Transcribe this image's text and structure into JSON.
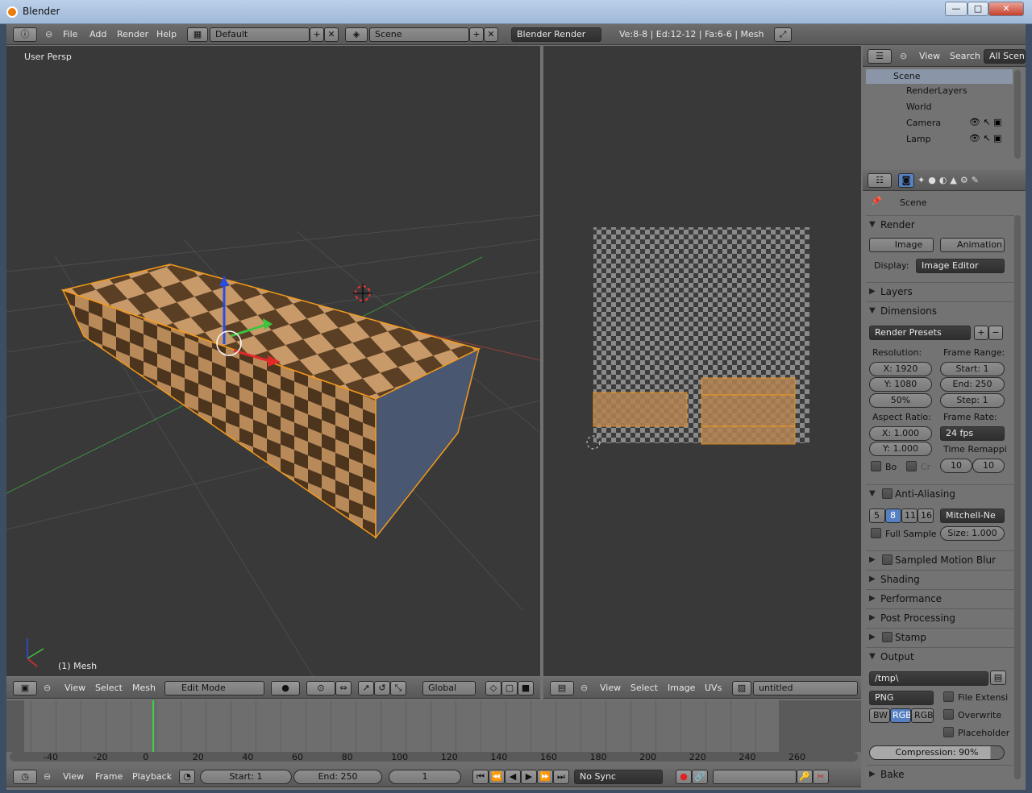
{
  "window": {
    "title": "Blender",
    "min": "—",
    "max": "□",
    "close": "✕"
  },
  "topbar": {
    "menus": [
      "File",
      "Add",
      "Render",
      "Help"
    ],
    "layout": "Default",
    "scene": "Scene",
    "engine": "Blender Render",
    "stats": "Ve:8-8 | Ed:12-12 | Fa:6-6 | Mesh"
  },
  "view3d": {
    "label": "User Persp",
    "object_label": "(1) Mesh",
    "header": {
      "menus": [
        "View",
        "Select",
        "Mesh"
      ],
      "mode": "Edit Mode",
      "orientation": "Global"
    }
  },
  "imageeditor": {
    "header": {
      "menus": [
        "View",
        "Select",
        "Image",
        "UVs"
      ],
      "image": "untitled"
    }
  },
  "outliner": {
    "menus": [
      "View",
      "Search"
    ],
    "filter": "All Scen",
    "items": [
      {
        "label": "Scene"
      },
      {
        "label": "RenderLayers"
      },
      {
        "label": "World"
      },
      {
        "label": "Camera"
      },
      {
        "label": "Lamp"
      }
    ]
  },
  "properties": {
    "context": "Scene",
    "render": {
      "title": "Render",
      "image_btn": "Image",
      "animation_btn": "Animation",
      "display_label": "Display:",
      "display_value": "Image Editor"
    },
    "collapsed": {
      "layers": "Layers",
      "dimensions": "Dimensions"
    },
    "dimensions": {
      "presets": "Render Presets",
      "resolution_label": "Resolution:",
      "res_x": "X: 1920",
      "res_y": "Y: 1080",
      "res_pct": "50%",
      "frame_range_label": "Frame Range:",
      "start": "Start: 1",
      "end": "End: 250",
      "step": "Step: 1",
      "aspect_label": "Aspect Ratio:",
      "asp_x": "X: 1.000",
      "asp_y": "Y: 1.000",
      "frame_rate_label": "Frame Rate:",
      "fps": "24 fps",
      "time_remap_label": "Time Remappi",
      "remap_old": "10",
      "remap_new": "10",
      "border": "Bo",
      "crop": "Cr"
    },
    "aa": {
      "title": "Anti-Aliasing",
      "samples": [
        "5",
        "8",
        "11",
        "16"
      ],
      "filter": "Mitchell-Ne",
      "full_sample": "Full Sample",
      "size": "Size: 1.000"
    },
    "panels": [
      "Sampled Motion Blur",
      "Shading",
      "Performance",
      "Post Processing",
      "Stamp"
    ],
    "output": {
      "title": "Output",
      "path": "/tmp\\",
      "format": "PNG",
      "file_ext": "File Extensi",
      "bw": "BW",
      "rgb": "RGB",
      "rgba": "RGB",
      "overwrite": "Overwrite",
      "placeholder": "Placeholder",
      "compression": "Compression: 90%",
      "bake": "Bake"
    }
  },
  "timeline": {
    "ticks": [
      "-40",
      "-20",
      "0",
      "20",
      "40",
      "60",
      "80",
      "100",
      "120",
      "140",
      "160",
      "180",
      "200",
      "220",
      "240",
      "260"
    ],
    "menus": [
      "View",
      "Frame",
      "Playback"
    ],
    "start": "Start: 1",
    "end": "End: 250",
    "current": "1",
    "sync": "No Sync"
  }
}
